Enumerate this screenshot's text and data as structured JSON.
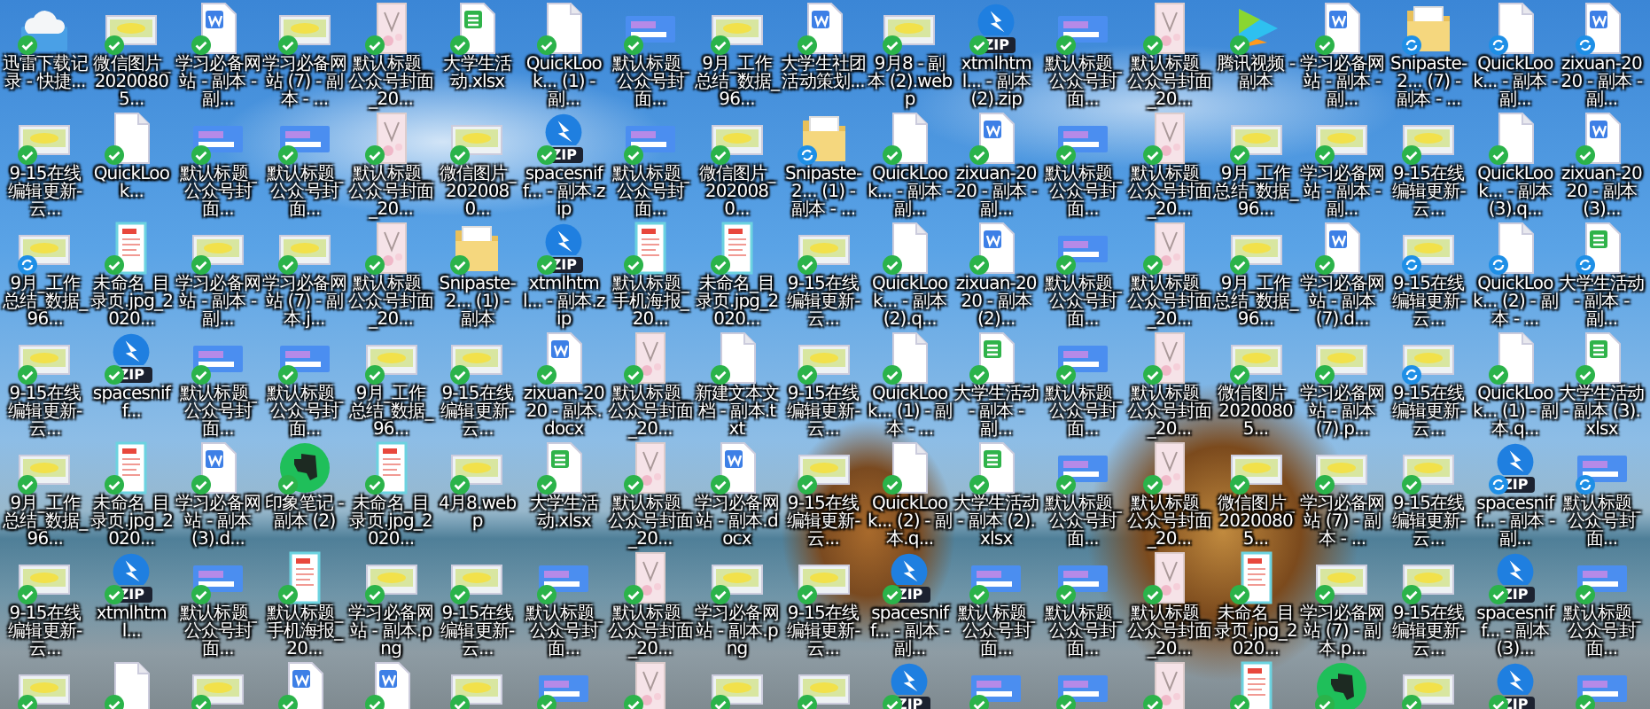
{
  "desktop": {
    "icons": [
      {
        "kind": "cloud",
        "label": "迅雷下载记录 - 快捷...",
        "synced": true
      },
      {
        "kind": "thumb",
        "label": "微信图片_20200805...",
        "synced": true
      },
      {
        "kind": "word",
        "label": "学习必备网站 - 副本 - 副...",
        "synced": true
      },
      {
        "kind": "thumb",
        "label": "学习必备网站 (7) - 副本 - ...",
        "synced": true
      },
      {
        "kind": "poster",
        "label": "默认标题_公众号封面_20...",
        "synced": true
      },
      {
        "kind": "sheet",
        "label": "大学生活动.xlsx",
        "synced": true
      },
      {
        "kind": "blank",
        "label": "QuickLook... (1) - 副...",
        "synced": true
      },
      {
        "kind": "banner",
        "label": "默认标题_公众号封面...",
        "synced": true
      },
      {
        "kind": "thumb",
        "label": "9月_工作总结_数据_96...",
        "synced": true
      },
      {
        "kind": "word",
        "label": "大学生社团活动策划...",
        "synced": true
      },
      {
        "kind": "thumb",
        "label": "9月8 - 副本 (2).webp",
        "synced": true
      },
      {
        "kind": "zip",
        "tag": "ZIP",
        "label": "xtmlhtml... - 副本 (2).zip",
        "synced": true
      },
      {
        "kind": "banner",
        "label": "默认标题_公众号封面...",
        "synced": true
      },
      {
        "kind": "poster",
        "label": "默认标题_公众号封面_20...",
        "synced": true
      },
      {
        "kind": "video",
        "label": "腾讯视频 - 副本",
        "synced": true
      },
      {
        "kind": "word",
        "label": "学习必备网站 - 副本 - 副...",
        "synced": true
      },
      {
        "kind": "folder",
        "label": "Snipaste-2... (7) - 副本 - ...",
        "synced": false
      },
      {
        "kind": "blank",
        "label": "QuickLook... - 副本 - 副...",
        "synced": false
      },
      {
        "kind": "word",
        "label": "zixuan-2020 - 副本 - 副...",
        "synced": false
      },
      {
        "kind": "thumb",
        "label": "9-15在线编辑更新-云...",
        "synced": true
      },
      {
        "kind": "blank",
        "label": "QuickLook...",
        "synced": true
      },
      {
        "kind": "banner",
        "label": "默认标题_公众号封面...",
        "synced": true
      },
      {
        "kind": "banner",
        "label": "默认标题_公众号封面...",
        "synced": true
      },
      {
        "kind": "poster",
        "label": "默认标题_公众号封面_20...",
        "synced": true
      },
      {
        "kind": "thumb",
        "label": "微信图片_2020080...",
        "synced": true
      },
      {
        "kind": "zip",
        "tag": "ZIP",
        "label": "spacesniff... - 副本.zip",
        "synced": true
      },
      {
        "kind": "banner",
        "label": "默认标题_公众号封面...",
        "synced": true
      },
      {
        "kind": "thumb",
        "label": "微信图片_2020080...",
        "synced": true
      },
      {
        "kind": "folder",
        "label": "Snipaste-2... (1) - 副本 - ...",
        "synced": false
      },
      {
        "kind": "blank",
        "label": "QuickLook... - 副本 - 副...",
        "synced": true
      },
      {
        "kind": "word",
        "label": "zixuan-2020 - 副本 - 副...",
        "synced": true
      },
      {
        "kind": "banner",
        "label": "默认标题_公众号封面...",
        "synced": true
      },
      {
        "kind": "poster",
        "label": "默认标题_公众号封面_20...",
        "synced": true
      },
      {
        "kind": "thumb",
        "label": "9月_工作总结_数据_96...",
        "synced": true
      },
      {
        "kind": "thumb",
        "label": "学习必备网站 - 副本 - 副...",
        "synced": true
      },
      {
        "kind": "thumb",
        "label": "9-15在线编辑更新-云...",
        "synced": true
      },
      {
        "kind": "blank",
        "label": "QuickLook... - 副本 (3).q...",
        "synced": true
      },
      {
        "kind": "word",
        "label": "zixuan-2020 - 副本 (3)...",
        "synced": true
      },
      {
        "kind": "thumb",
        "label": "9月_工作总结_数据_96...",
        "synced": false
      },
      {
        "kind": "redoc",
        "label": "未命名_目录页.jpg_2020...",
        "synced": true
      },
      {
        "kind": "thumb",
        "label": "学习必备网站 - 副本 - 副...",
        "synced": true
      },
      {
        "kind": "thumb",
        "label": "学习必备网站 (7) - 副本.j...",
        "synced": true
      },
      {
        "kind": "poster",
        "label": "默认标题_公众号封面_20...",
        "synced": true
      },
      {
        "kind": "folder",
        "label": "Snipaste-2... (1) - 副本",
        "synced": true
      },
      {
        "kind": "zip",
        "tag": "ZIP",
        "label": "xtmlhtml... - 副本.zip",
        "synced": true
      },
      {
        "kind": "redoc",
        "label": "默认标题_手机海报_20...",
        "synced": true
      },
      {
        "kind": "redoc",
        "label": "未命名_目录页.jpg_2020...",
        "synced": true
      },
      {
        "kind": "thumb",
        "label": "9-15在线编辑更新-云...",
        "synced": true
      },
      {
        "kind": "blank",
        "label": "QuickLook... - 副本 (2).q...",
        "synced": true
      },
      {
        "kind": "word",
        "label": "zixuan-2020 - 副本 (2)...",
        "synced": true
      },
      {
        "kind": "banner",
        "label": "默认标题_公众号封面...",
        "synced": true
      },
      {
        "kind": "poster",
        "label": "默认标题_公众号封面_20...",
        "synced": true
      },
      {
        "kind": "thumb",
        "label": "9月_工作总结_数据_96...",
        "synced": true
      },
      {
        "kind": "word",
        "label": "学习必备网站 - 副本 (7).d...",
        "synced": true
      },
      {
        "kind": "thumb",
        "label": "9-15在线编辑更新-云...",
        "synced": false
      },
      {
        "kind": "blank",
        "label": "QuickLook... (2) - 副本 - ...",
        "synced": false
      },
      {
        "kind": "sheet",
        "label": "大学生活动 - 副本 - 副...",
        "synced": false
      },
      {
        "kind": "thumb",
        "label": "9-15在线编辑更新-云...",
        "synced": true
      },
      {
        "kind": "zip",
        "tag": "ZIP",
        "label": "spacesniff...",
        "synced": true
      },
      {
        "kind": "banner",
        "label": "默认标题_公众号封面...",
        "synced": true
      },
      {
        "kind": "banner",
        "label": "默认标题_公众号封面...",
        "synced": true
      },
      {
        "kind": "thumb",
        "label": "9月_工作总结_数据_96...",
        "synced": true
      },
      {
        "kind": "thumb",
        "label": "9-15在线编辑更新-云...",
        "synced": true
      },
      {
        "kind": "word",
        "label": "zixuan-2020 - 副本.docx",
        "synced": true
      },
      {
        "kind": "poster",
        "label": "默认标题_公众号封面_20...",
        "synced": true
      },
      {
        "kind": "blank",
        "label": "新建文本文档 - 副本.txt",
        "synced": true
      },
      {
        "kind": "thumb",
        "label": "9-15在线编辑更新-云...",
        "synced": true
      },
      {
        "kind": "blank",
        "label": "QuickLook... (1) - 副本 - ...",
        "synced": true
      },
      {
        "kind": "sheet",
        "label": "大学生活动 - 副本 - 副...",
        "synced": true
      },
      {
        "kind": "banner",
        "label": "默认标题_公众号封面...",
        "synced": true
      },
      {
        "kind": "poster",
        "label": "默认标题_公众号封面_20...",
        "synced": true
      },
      {
        "kind": "thumb",
        "label": "微信图片_20200805...",
        "synced": true
      },
      {
        "kind": "thumb",
        "label": "学习必备网站 - 副本 (7).p...",
        "synced": true
      },
      {
        "kind": "thumb",
        "label": "9-15在线编辑更新-云...",
        "synced": false
      },
      {
        "kind": "blank",
        "label": "QuickLook... (1) - 副本.q...",
        "synced": true
      },
      {
        "kind": "sheet",
        "label": "大学生活动 - 副本 (3).xlsx",
        "synced": true
      },
      {
        "kind": "thumb",
        "label": "9月_工作总结_数据_96...",
        "synced": true
      },
      {
        "kind": "redoc",
        "label": "未命名_目录页.jpg_2020...",
        "synced": true
      },
      {
        "kind": "word",
        "label": "学习必备网站 - 副本 (3).d...",
        "synced": true
      },
      {
        "kind": "evernote",
        "label": "印象笔记 - 副本 (2)",
        "synced": true
      },
      {
        "kind": "redoc",
        "label": "未命名_目录页.jpg_2020...",
        "synced": true
      },
      {
        "kind": "thumb",
        "label": "4月8.webp",
        "synced": true
      },
      {
        "kind": "sheet",
        "label": "大学生活动.xlsx",
        "synced": true
      },
      {
        "kind": "poster",
        "label": "默认标题_公众号封面_20...",
        "synced": true
      },
      {
        "kind": "word",
        "label": "学习必备网站 - 副本.docx",
        "synced": true
      },
      {
        "kind": "thumb",
        "label": "9-15在线编辑更新-云...",
        "synced": true
      },
      {
        "kind": "blank",
        "label": "QuickLook... (2) - 副本.q...",
        "synced": true
      },
      {
        "kind": "sheet",
        "label": "大学生活动 - 副本 (2).xlsx",
        "synced": true
      },
      {
        "kind": "banner",
        "label": "默认标题_公众号封面...",
        "synced": true
      },
      {
        "kind": "poster",
        "label": "默认标题_公众号封面_20...",
        "synced": true
      },
      {
        "kind": "thumb",
        "label": "微信图片_20200805...",
        "synced": true
      },
      {
        "kind": "thumb",
        "label": "学习必备网站 (7) - 副本 - ...",
        "synced": true
      },
      {
        "kind": "thumb",
        "label": "9-15在线编辑更新-云...",
        "synced": true
      },
      {
        "kind": "zip",
        "tag": "ZIP",
        "label": "spacesniff... - 副本 - 副...",
        "synced": false
      },
      {
        "kind": "banner",
        "label": "默认标题_公众号封面...",
        "synced": false
      },
      {
        "kind": "thumb",
        "label": "9-15在线编辑更新-云...",
        "synced": true
      },
      {
        "kind": "zip",
        "tag": "ZIP",
        "label": "xtmlhtml...",
        "synced": true
      },
      {
        "kind": "banner",
        "label": "默认标题_公众号封面...",
        "synced": true
      },
      {
        "kind": "redoc",
        "label": "默认标题_手机海报_20...",
        "synced": true
      },
      {
        "kind": "thumb",
        "label": "学习必备网站 - 副本.png",
        "synced": true
      },
      {
        "kind": "thumb",
        "label": "9-15在线编辑更新-云...",
        "synced": true
      },
      {
        "kind": "banner",
        "label": "默认标题_公众号封面...",
        "synced": true
      },
      {
        "kind": "poster",
        "label": "默认标题_公众号封面_20...",
        "synced": true
      },
      {
        "kind": "thumb",
        "label": "学习必备网站 - 副本.png",
        "synced": true
      },
      {
        "kind": "thumb",
        "label": "9-15在线编辑更新-云...",
        "synced": true
      },
      {
        "kind": "zip",
        "tag": "ZIP",
        "label": "spacesniff... - 副本 - 副...",
        "synced": true
      },
      {
        "kind": "banner",
        "label": "默认标题_公众号封面...",
        "synced": true
      },
      {
        "kind": "banner",
        "label": "默认标题_公众号封面...",
        "synced": true
      },
      {
        "kind": "poster",
        "label": "默认标题_公众号封面_20...",
        "synced": true
      },
      {
        "kind": "redoc",
        "label": "未命名_目录页.jpg_2020...",
        "synced": true
      },
      {
        "kind": "thumb",
        "label": "学习必备网站 (7) - 副本.p...",
        "synced": true
      },
      {
        "kind": "thumb",
        "label": "9-15在线编辑更新-云...",
        "synced": true
      },
      {
        "kind": "zip",
        "tag": "ZIP",
        "label": "spacesniff... - 副本 (3)...",
        "synced": true
      },
      {
        "kind": "banner",
        "label": "默认标题_公众号封面...",
        "synced": true
      },
      {
        "kind": "thumb",
        "synced": true
      },
      {
        "kind": "blank",
        "synced": true
      },
      {
        "kind": "thumb",
        "synced": true
      },
      {
        "kind": "word",
        "synced": true
      },
      {
        "kind": "word",
        "synced": true
      },
      {
        "kind": "thumb",
        "synced": true
      },
      {
        "kind": "banner",
        "synced": true
      },
      {
        "kind": "poster",
        "synced": true
      },
      {
        "kind": "thumb",
        "synced": true
      },
      {
        "kind": "thumb",
        "synced": true
      },
      {
        "kind": "zip",
        "tag": "ZIP",
        "synced": true
      },
      {
        "kind": "banner",
        "synced": true
      },
      {
        "kind": "banner",
        "synced": true
      },
      {
        "kind": "poster",
        "synced": true
      },
      {
        "kind": "redoc",
        "synced": true
      },
      {
        "kind": "evernote",
        "synced": true
      },
      {
        "kind": "thumb",
        "synced": true
      },
      {
        "kind": "zip",
        "tag": "ZIP",
        "synced": true
      },
      {
        "kind": "banner",
        "synced": true
      }
    ]
  }
}
